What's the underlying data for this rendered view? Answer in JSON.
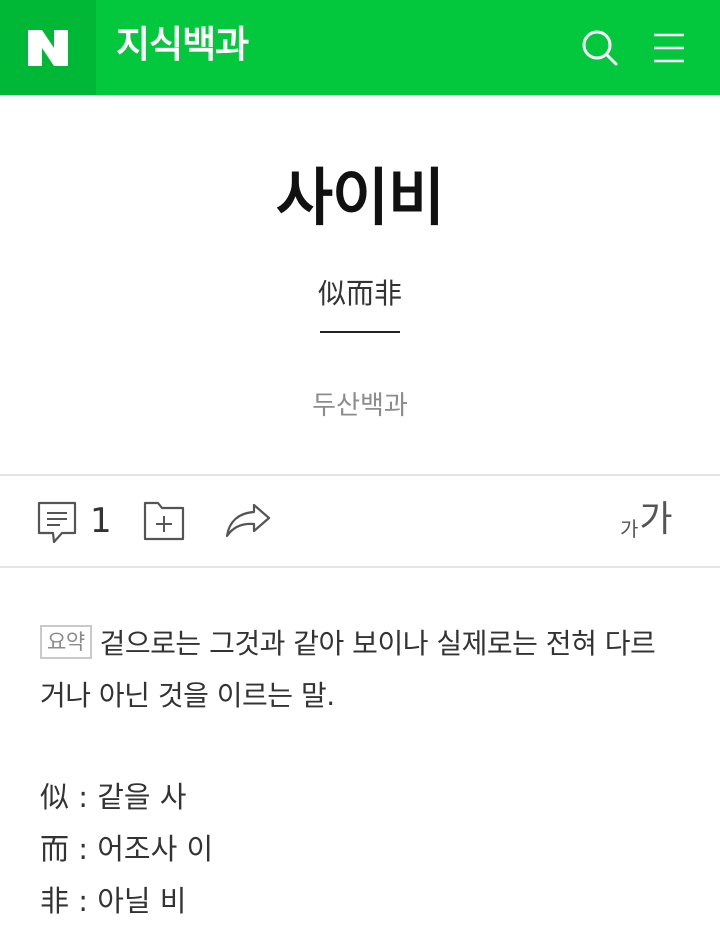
{
  "header": {
    "logo_letter": "N",
    "title": "지식백과",
    "search_icon": "search-icon",
    "menu_icon": "hamburger-menu-icon",
    "brand_color": "#03c83e"
  },
  "entry": {
    "title": "사이비",
    "hanja": "似而非",
    "source": "두산백과"
  },
  "toolbar": {
    "comment_count": "1",
    "comment_icon": "comment-icon",
    "save_icon": "folder-add-icon",
    "share_icon": "share-icon",
    "font_small": "가",
    "font_large": "가"
  },
  "body": {
    "summary_badge": "요약",
    "summary_text": "겉으로는 그것과 같아 보이나 실제로는 전혀 다르거나 아닌 것을 이르는 말.",
    "hanja_breakdown": [
      "似 : 같을 사",
      "而 : 어조사 이",
      "非 : 아닐 비"
    ]
  }
}
